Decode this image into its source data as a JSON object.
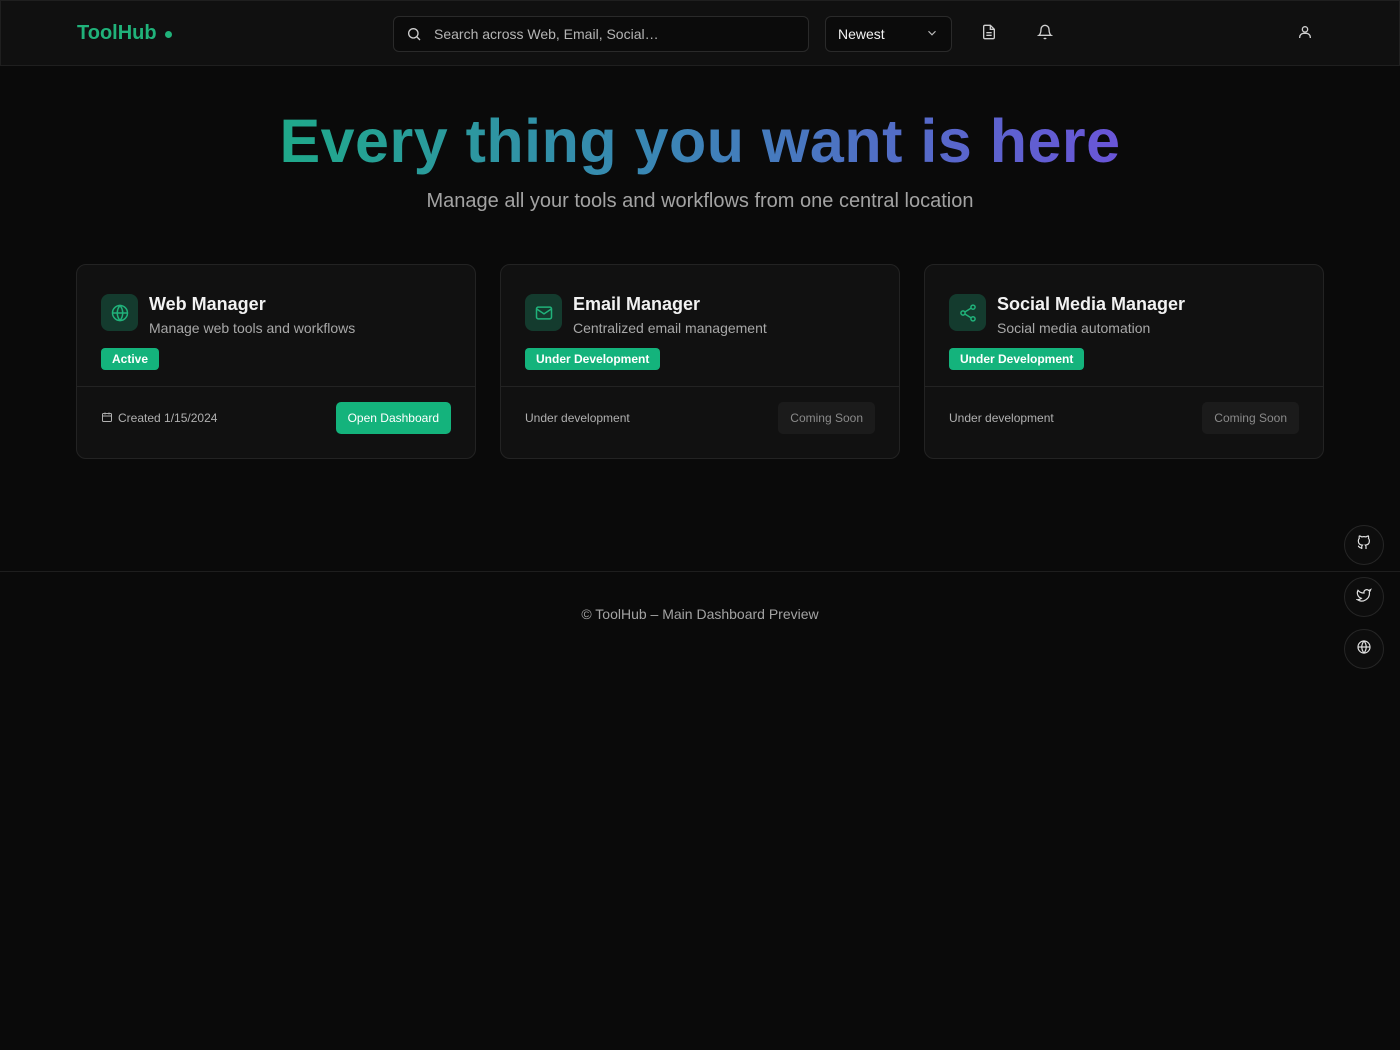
{
  "header": {
    "brand": "ToolHub",
    "search_placeholder": "Search across Web, Email, Social…",
    "sort_selected": "Newest",
    "icons": [
      "document-icon",
      "bell-icon",
      "user-icon"
    ]
  },
  "hero": {
    "title": "Every thing you want is here",
    "subtitle": "Manage all your tools and workflows from one central location"
  },
  "cards": [
    {
      "icon": "globe-icon",
      "title": "Web Manager",
      "description": "Manage web tools and workflows",
      "badge": "Active",
      "footer_text": "Created 1/15/2024",
      "action": "Open Dashboard"
    },
    {
      "icon": "mail-icon",
      "title": "Email Manager",
      "description": "Centralized email management",
      "badge": "Under Development",
      "footer_text": "Under development",
      "action": "Coming Soon"
    },
    {
      "icon": "share-icon",
      "title": "Social Media Manager",
      "description": "Social media automation",
      "badge": "Under Development",
      "footer_text": "Under development",
      "action": "Coming Soon"
    }
  ],
  "footer": {
    "text": "© ToolHub – Main Dashboard Preview"
  },
  "floating": [
    "github-icon",
    "twitter-icon",
    "globe-icon"
  ],
  "colors": {
    "accent": "#14b37c",
    "background": "#0a0a0a",
    "gradient_start": "#1fa98a",
    "gradient_end": "#6a55d8"
  }
}
